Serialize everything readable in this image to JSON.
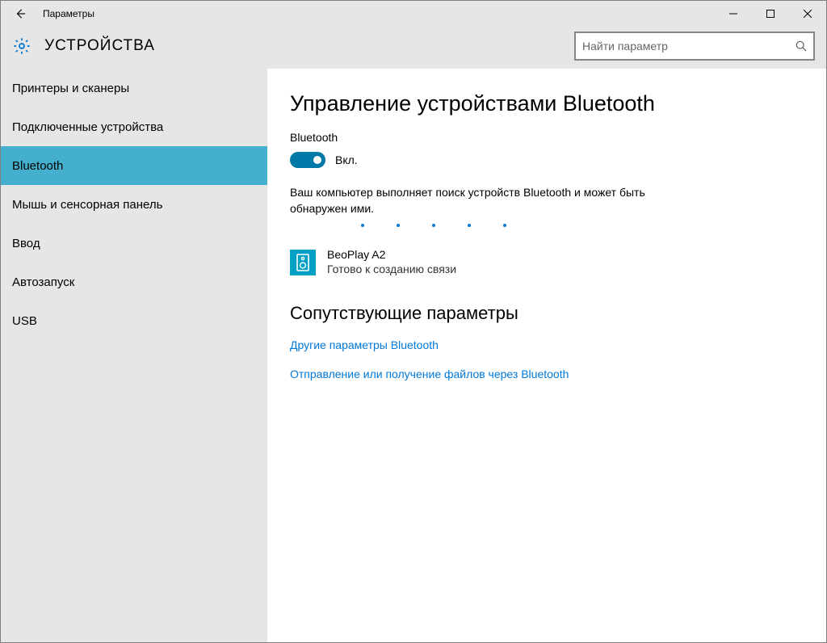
{
  "window": {
    "title": "Параметры"
  },
  "header": {
    "title": "УСТРОЙСТВА",
    "search_placeholder": "Найти параметр"
  },
  "sidebar": {
    "items": [
      {
        "label": "Принтеры и сканеры",
        "active": false
      },
      {
        "label": "Подключенные устройства",
        "active": false
      },
      {
        "label": "Bluetooth",
        "active": true
      },
      {
        "label": "Мышь и сенсорная панель",
        "active": false
      },
      {
        "label": "Ввод",
        "active": false
      },
      {
        "label": "Автозапуск",
        "active": false
      },
      {
        "label": "USB",
        "active": false
      }
    ]
  },
  "main": {
    "heading": "Управление устройствами Bluetooth",
    "feature_label": "Bluetooth",
    "toggle_state": "Вкл.",
    "status_text": "Ваш компьютер выполняет поиск устройств Bluetooth и может быть обнаружен ими.",
    "device": {
      "name": "BeoPlay A2",
      "status": "Готово к созданию связи"
    },
    "related_heading": "Сопутствующие параметры",
    "links": [
      "Другие параметры Bluetooth",
      "Отправление или получение файлов через Bluetooth"
    ]
  }
}
